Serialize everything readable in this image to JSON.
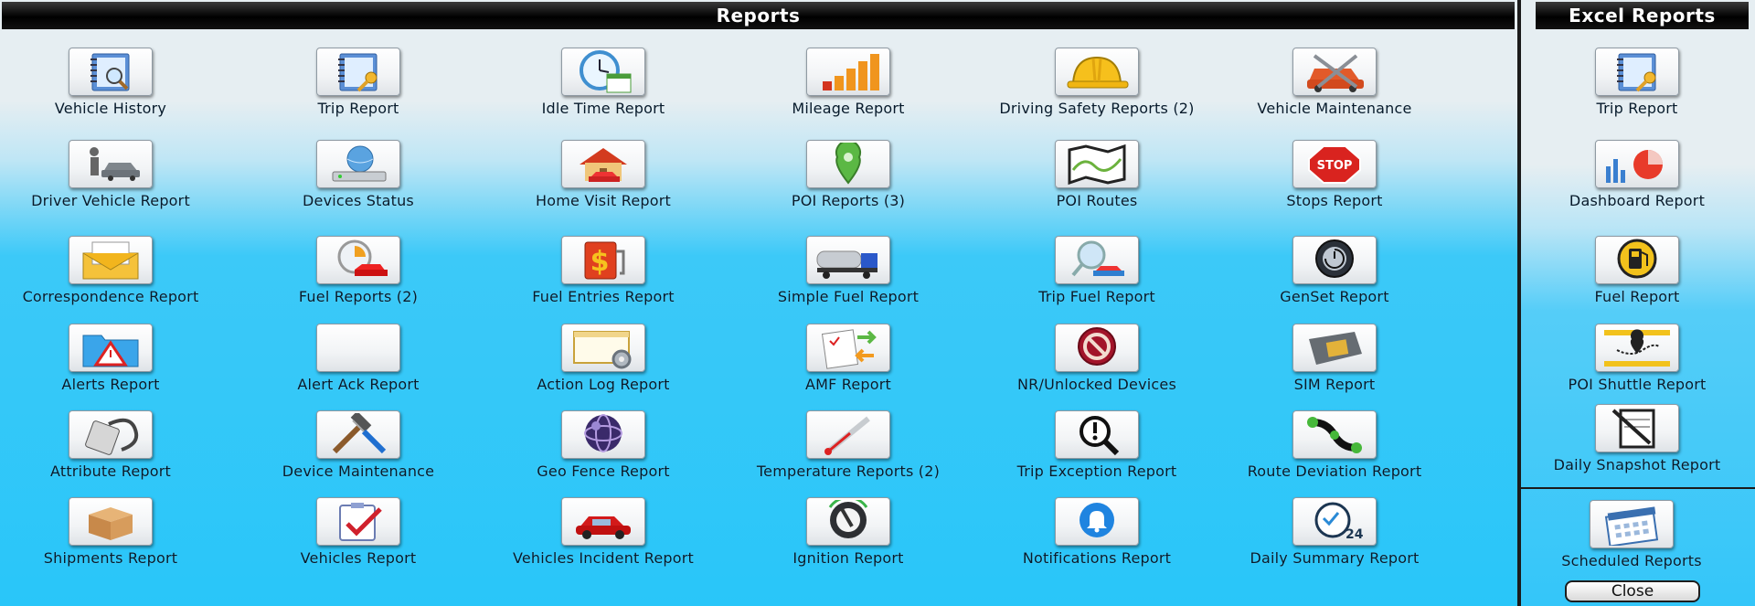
{
  "header": {
    "reports_title": "Reports",
    "excel_title": "Excel Reports"
  },
  "reports": [
    {
      "label": "Vehicle History",
      "icon": "notebook-search-icon"
    },
    {
      "label": "Trip Report",
      "icon": "notebook-key-icon"
    },
    {
      "label": "Idle Time Report",
      "icon": "clock-calendar-icon"
    },
    {
      "label": "Mileage Report",
      "icon": "bar-chart-icon"
    },
    {
      "label": "Driving Safety Reports (2)",
      "icon": "hard-hat-icon"
    },
    {
      "label": "Vehicle Maintenance",
      "icon": "car-tools-icon"
    },
    {
      "label": "Driver Vehicle Report",
      "icon": "driver-car-icon"
    },
    {
      "label": "Devices Status",
      "icon": "network-device-icon"
    },
    {
      "label": "Home Visit Report",
      "icon": "house-car-icon"
    },
    {
      "label": "POI Reports (3)",
      "icon": "map-pin-icon"
    },
    {
      "label": "POI Routes",
      "icon": "route-map-icon"
    },
    {
      "label": "Stops Report",
      "icon": "stop-sign-icon"
    },
    {
      "label": "Correspondence Report",
      "icon": "envelope-icon"
    },
    {
      "label": "Fuel Reports (2)",
      "icon": "stopwatch-car-icon"
    },
    {
      "label": "Fuel Entries Report",
      "icon": "fuel-pump-dollar-icon"
    },
    {
      "label": "Simple Fuel Report",
      "icon": "tanker-truck-icon"
    },
    {
      "label": "Trip Fuel Report",
      "icon": "magnifier-car-icon"
    },
    {
      "label": "GenSet Report",
      "icon": "timer-dial-icon"
    },
    {
      "label": "Alerts Report",
      "icon": "folder-warning-icon"
    },
    {
      "label": "Alert Ack Report",
      "icon": "blank-icon"
    },
    {
      "label": "Action Log Report",
      "icon": "window-gear-icon"
    },
    {
      "label": "AMF Report",
      "icon": "checklist-arrows-icon"
    },
    {
      "label": "NR/Unlocked Devices",
      "icon": "prohibited-icon"
    },
    {
      "label": "SIM Report",
      "icon": "sim-card-icon"
    },
    {
      "label": "Attribute Report",
      "icon": "tag-cable-icon"
    },
    {
      "label": "Device Maintenance",
      "icon": "hammer-screwdriver-icon"
    },
    {
      "label": "Geo Fence Report",
      "icon": "globe-icon"
    },
    {
      "label": "Temperature Reports (2)",
      "icon": "thermometer-icon"
    },
    {
      "label": "Trip Exception Report",
      "icon": "magnifier-exclamation-icon"
    },
    {
      "label": "Route Deviation Report",
      "icon": "route-deviation-icon"
    },
    {
      "label": "Shipments Report",
      "icon": "cardboard-box-icon"
    },
    {
      "label": "Vehicles Report",
      "icon": "clipboard-check-icon"
    },
    {
      "label": "Vehicles Incident Report",
      "icon": "red-car-icon"
    },
    {
      "label": "Ignition Report",
      "icon": "ignition-dial-icon"
    },
    {
      "label": "Notifications Report",
      "icon": "bell-icon"
    },
    {
      "label": "Daily Summary Report",
      "icon": "clock-24-icon"
    }
  ],
  "excel_reports": [
    {
      "label": "Trip Report",
      "icon": "notebook-key-icon"
    },
    {
      "label": "Dashboard Report",
      "icon": "dashboard-chart-icon"
    },
    {
      "label": "Fuel Report",
      "icon": "fuel-pump-icon"
    },
    {
      "label": "POI Shuttle Report",
      "icon": "shuttle-route-icon"
    },
    {
      "label": "Daily Snapshot Report",
      "icon": "clipboard-pen-icon"
    }
  ],
  "scheduled": {
    "label": "Scheduled Reports",
    "icon": "calendar-icon"
  },
  "close_label": "Close"
}
